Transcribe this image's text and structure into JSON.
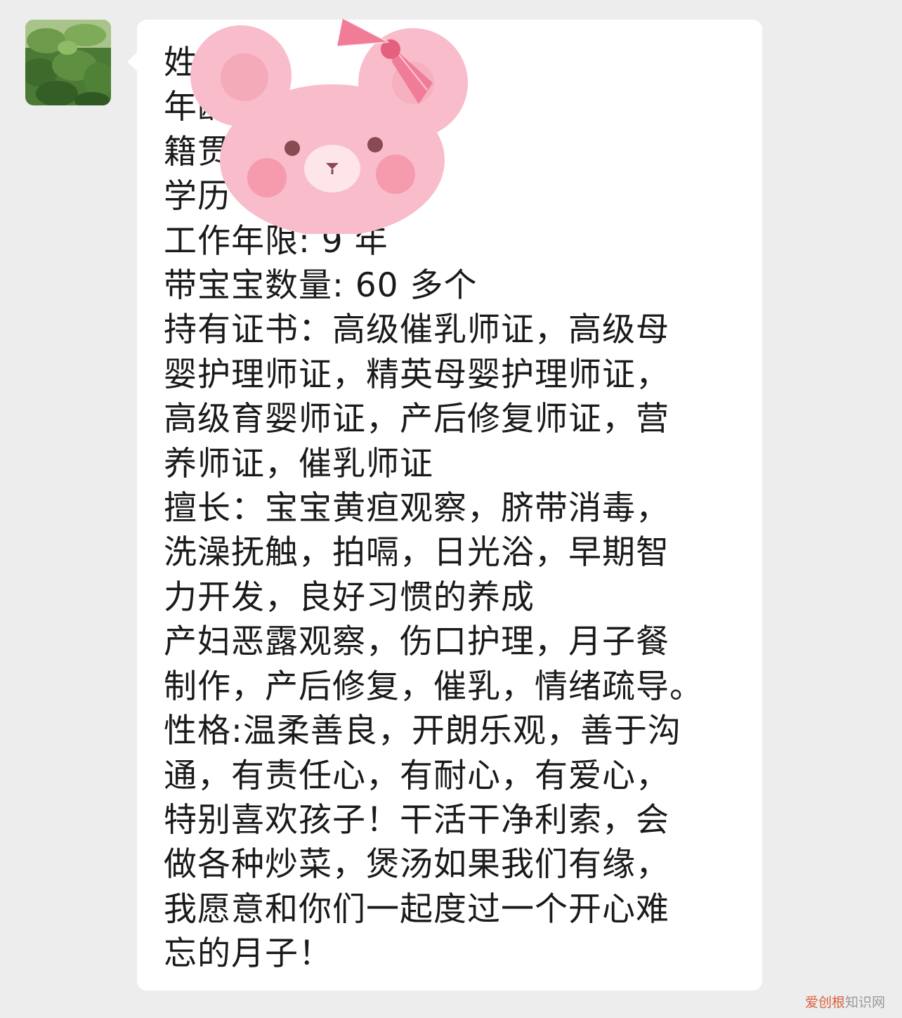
{
  "chat": {
    "message_lines": [
      "姓名",
      "年龄",
      "籍贯",
      "学历",
      "工作年限: 9 年",
      "带宝宝数量: 60 多个",
      "持有证书：高级催乳师证，高级母",
      "婴护理师证，精英母婴护理师证，",
      "高级育婴师证，产后修复师证，营",
      "养师证，催乳师证",
      "擅长：宝宝黄疸观察，脐带消毒，",
      "洗澡抚触，拍嗝，日光浴，早期智",
      "力开发，良好习惯的养成",
      "产妇恶露观察，伤口护理，月子餐",
      "制作，产后修复，催乳，情绪疏导。",
      "性格:温柔善良，开朗乐观，善于沟",
      "通，有责任心，有耐心，有爱心，",
      "特别喜欢孩子！干活干净利索，会",
      "做各种炒菜，煲汤如果我们有缘，",
      "我愿意和你们一起度过一个开心难",
      "忘的月子！"
    ]
  },
  "icons": {
    "avatar": "avatar-photo-icon",
    "sticker": "pink-bear-sticker-icon"
  },
  "watermark": {
    "brand": "爱创根",
    "suffix": "知识网"
  },
  "colors": {
    "background": "#ededed",
    "bubble": "#ffffff",
    "text": "#1a1a1a",
    "bear": "#f8bcc8",
    "bow": "#f07c98"
  }
}
